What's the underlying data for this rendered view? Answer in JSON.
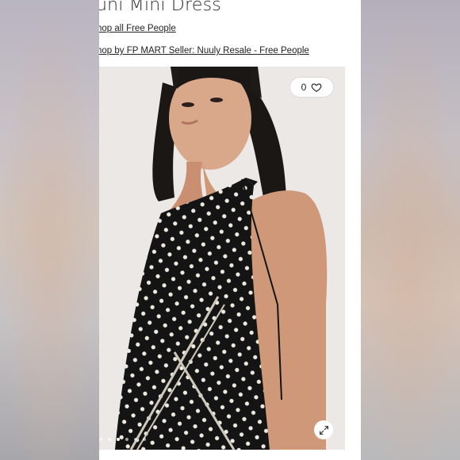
{
  "product": {
    "title": "uni Mini Dress",
    "shop_link": "hop all Free People",
    "seller_link": "hop by FP MART Seller: Nuuly Resale - Free People"
  },
  "gallery": {
    "like_count": "0",
    "icons": [
      "heart-icon",
      "expand-icon"
    ],
    "dot_count": 6,
    "active_dot": 2
  }
}
